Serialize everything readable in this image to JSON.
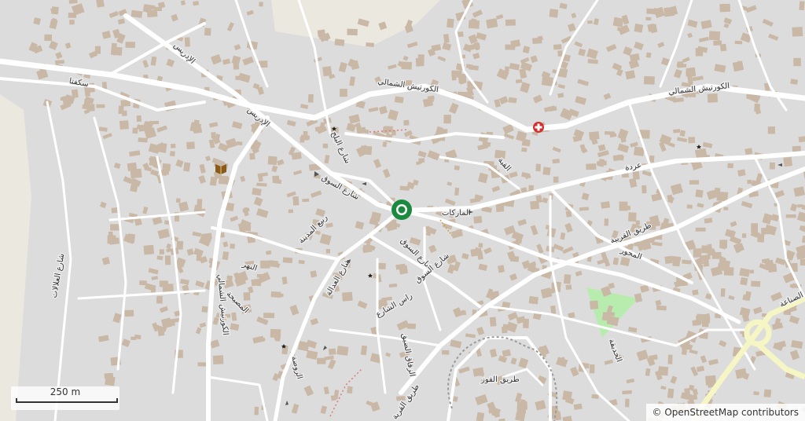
{
  "map": {
    "attribution": "© OpenStreetMap contributors",
    "scale_label": "250 m",
    "colors": {
      "land": "#dcdcdc",
      "building": "#c9b8a6",
      "road": "#ffffff",
      "main_road": "#f6f6c4",
      "park": "#b8ecae",
      "marker": "#1b8a3e",
      "bare": "#ebe8e0",
      "hospital": "#d32f2f"
    },
    "street_labels": [
      "سكفتا",
      "الإدريس",
      "الإدريس",
      "الكورنيش الشمالي",
      "الكورنيش الشمالي",
      "شارع البلح",
      "شارع السوق",
      "شارع السوق",
      "ربيع المدينة",
      "القبة",
      "عردة",
      "الماركات",
      "طريق القريبة",
      "الكورنيش الشمالي",
      "شارع العلالات",
      "المصيحة",
      "النهر",
      "شارع العدالة",
      "شارع السوق",
      "راس الشارع",
      "الزقاق الضيق",
      "الروضة",
      "طريق الفوز",
      "طريق القرية",
      "الحديقة",
      "المحور",
      "الصناعة"
    ],
    "icons": [
      "mosque-icon",
      "mosque-icon",
      "mosque-icon",
      "mosque-icon",
      "hospital-icon",
      "library-icon",
      "location-marker-icon"
    ]
  }
}
